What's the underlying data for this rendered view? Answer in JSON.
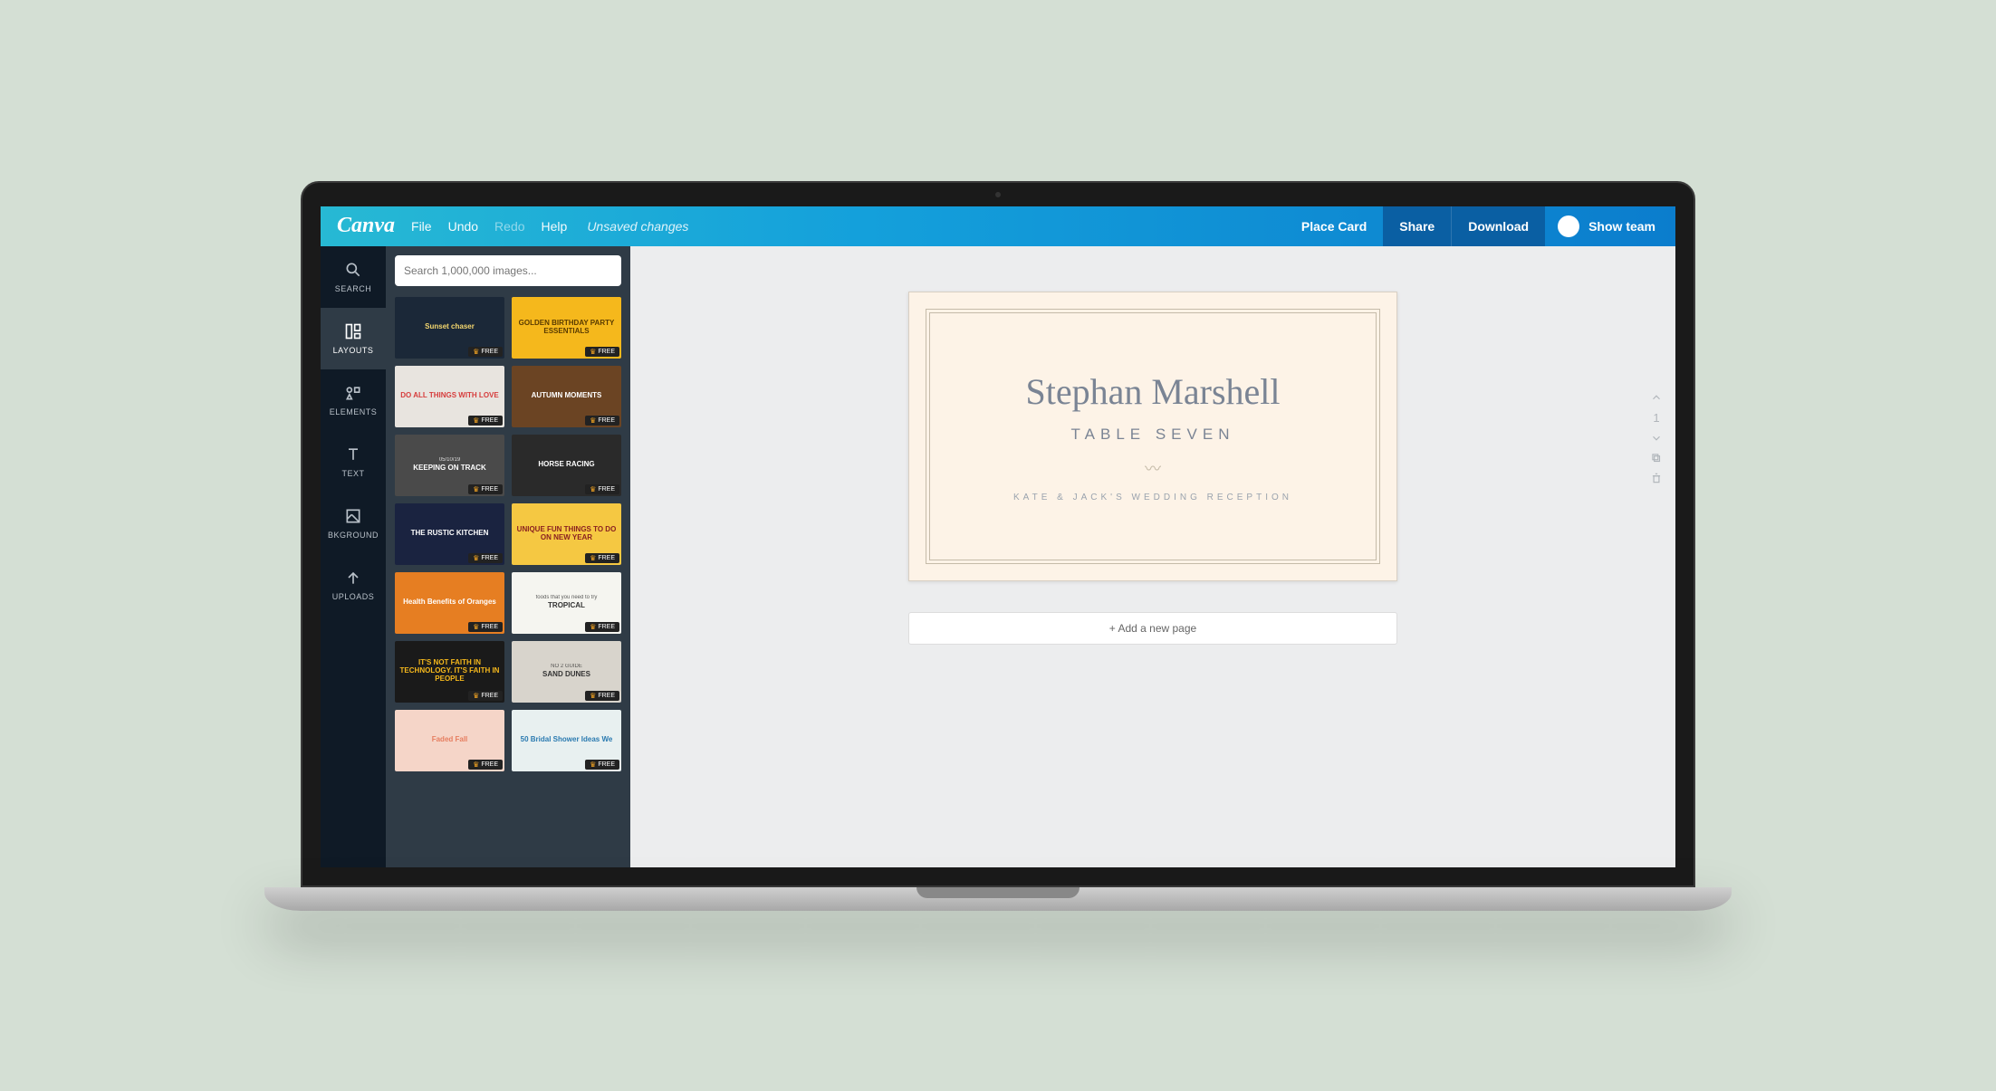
{
  "brand": "Canva",
  "menu": {
    "file": "File",
    "undo": "Undo",
    "redo": "Redo",
    "help": "Help",
    "unsaved": "Unsaved changes"
  },
  "doc_title": "Place Card",
  "buttons": {
    "share": "Share",
    "download": "Download",
    "showteam": "Show team"
  },
  "sidebar": [
    {
      "label": "SEARCH",
      "key": "search"
    },
    {
      "label": "LAYOUTS",
      "key": "layouts"
    },
    {
      "label": "ELEMENTS",
      "key": "elements"
    },
    {
      "label": "TEXT",
      "key": "text"
    },
    {
      "label": "BKGROUND",
      "key": "bkground"
    },
    {
      "label": "UPLOADS",
      "key": "uploads"
    }
  ],
  "search": {
    "placeholder": "Search 1,000,000 images..."
  },
  "free_label": "FREE",
  "templates": [
    {
      "title": "Sunset chaser",
      "bg": "#1b2838",
      "color": "#f5d76e"
    },
    {
      "title": "GOLDEN BIRTHDAY PARTY ESSENTIALS",
      "bg": "#f5b81c",
      "color": "#5a3b00"
    },
    {
      "title": "DO ALL THINGS WITH LOVE",
      "bg": "#e8e4df",
      "color": "#d63c3c"
    },
    {
      "title": "AUTUMN MOMENTS",
      "bg": "#6b4423",
      "color": "#fff"
    },
    {
      "title": "KEEPING ON TRACK",
      "sub": "05/10/19",
      "bg": "#4a4a4a",
      "color": "#fff"
    },
    {
      "title": "HORSE RACING",
      "bg": "#2a2a2a",
      "color": "#fff"
    },
    {
      "title": "THE RUSTIC KITCHEN",
      "bg": "#1a2340",
      "color": "#fff"
    },
    {
      "title": "UNIQUE FUN THINGS TO DO ON NEW YEAR",
      "bg": "#f5c842",
      "color": "#8a2020"
    },
    {
      "title": "Health Benefits of Oranges",
      "bg": "#e67e22",
      "color": "#fff"
    },
    {
      "title": "TROPICAL",
      "sub": "foods that you need to try",
      "bg": "#f5f5f0",
      "color": "#333"
    },
    {
      "title": "IT'S NOT FAITH IN TECHNOLOGY. IT'S FAITH IN PEOPLE",
      "bg": "#1a1a1a",
      "color": "#f5b81c"
    },
    {
      "title": "SAND DUNES",
      "sub": "NO 2 GUIDE",
      "bg": "#d8d4cc",
      "color": "#333"
    },
    {
      "title": "Faded Fall",
      "bg": "#f5d5c8",
      "color": "#e67e60"
    },
    {
      "title": "50 Bridal Shower Ideas We",
      "bg": "#e8f0f0",
      "color": "#2a7ab0"
    }
  ],
  "card": {
    "name": "Stephan Marshell",
    "table": "TABLE SEVEN",
    "reception": "KATE & JACK'S WEDDING RECEPTION"
  },
  "add_page": "+ Add a new page",
  "page_number": "1"
}
